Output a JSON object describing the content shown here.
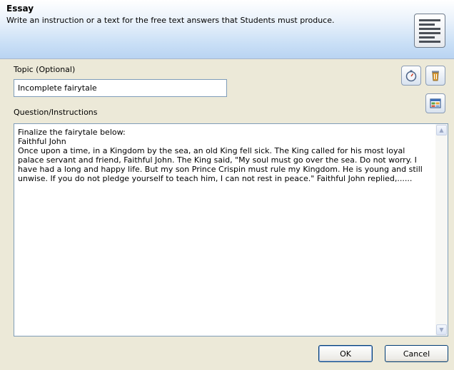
{
  "header": {
    "title": "Essay",
    "description": "Write an instruction or a text for the free text answers that Students must produce.",
    "icon": "essay-lines-icon"
  },
  "topic": {
    "label": "Topic (Optional)",
    "value": "Incomplete fairytale"
  },
  "tools": {
    "timer_icon": "stopwatch-icon",
    "delete_icon": "trash-icon",
    "table_icon": "table-icon"
  },
  "question": {
    "label": "Question/Instructions",
    "text": "Finalize the fairytale below:\nFaithful John\nOnce upon a time, in a Kingdom by the sea, an old King fell sick. The King called for his most loyal palace servant and friend, Faithful John. The King said, \"My soul must go over the sea. Do not worry. I have had a long and happy life. But my son Prince Crispin must rule my Kingdom. He is young and still unwise. If you do not pledge yourself to teach him, I can not rest in peace.\" Faithful John replied,......"
  },
  "buttons": {
    "ok": "OK",
    "cancel": "Cancel"
  }
}
